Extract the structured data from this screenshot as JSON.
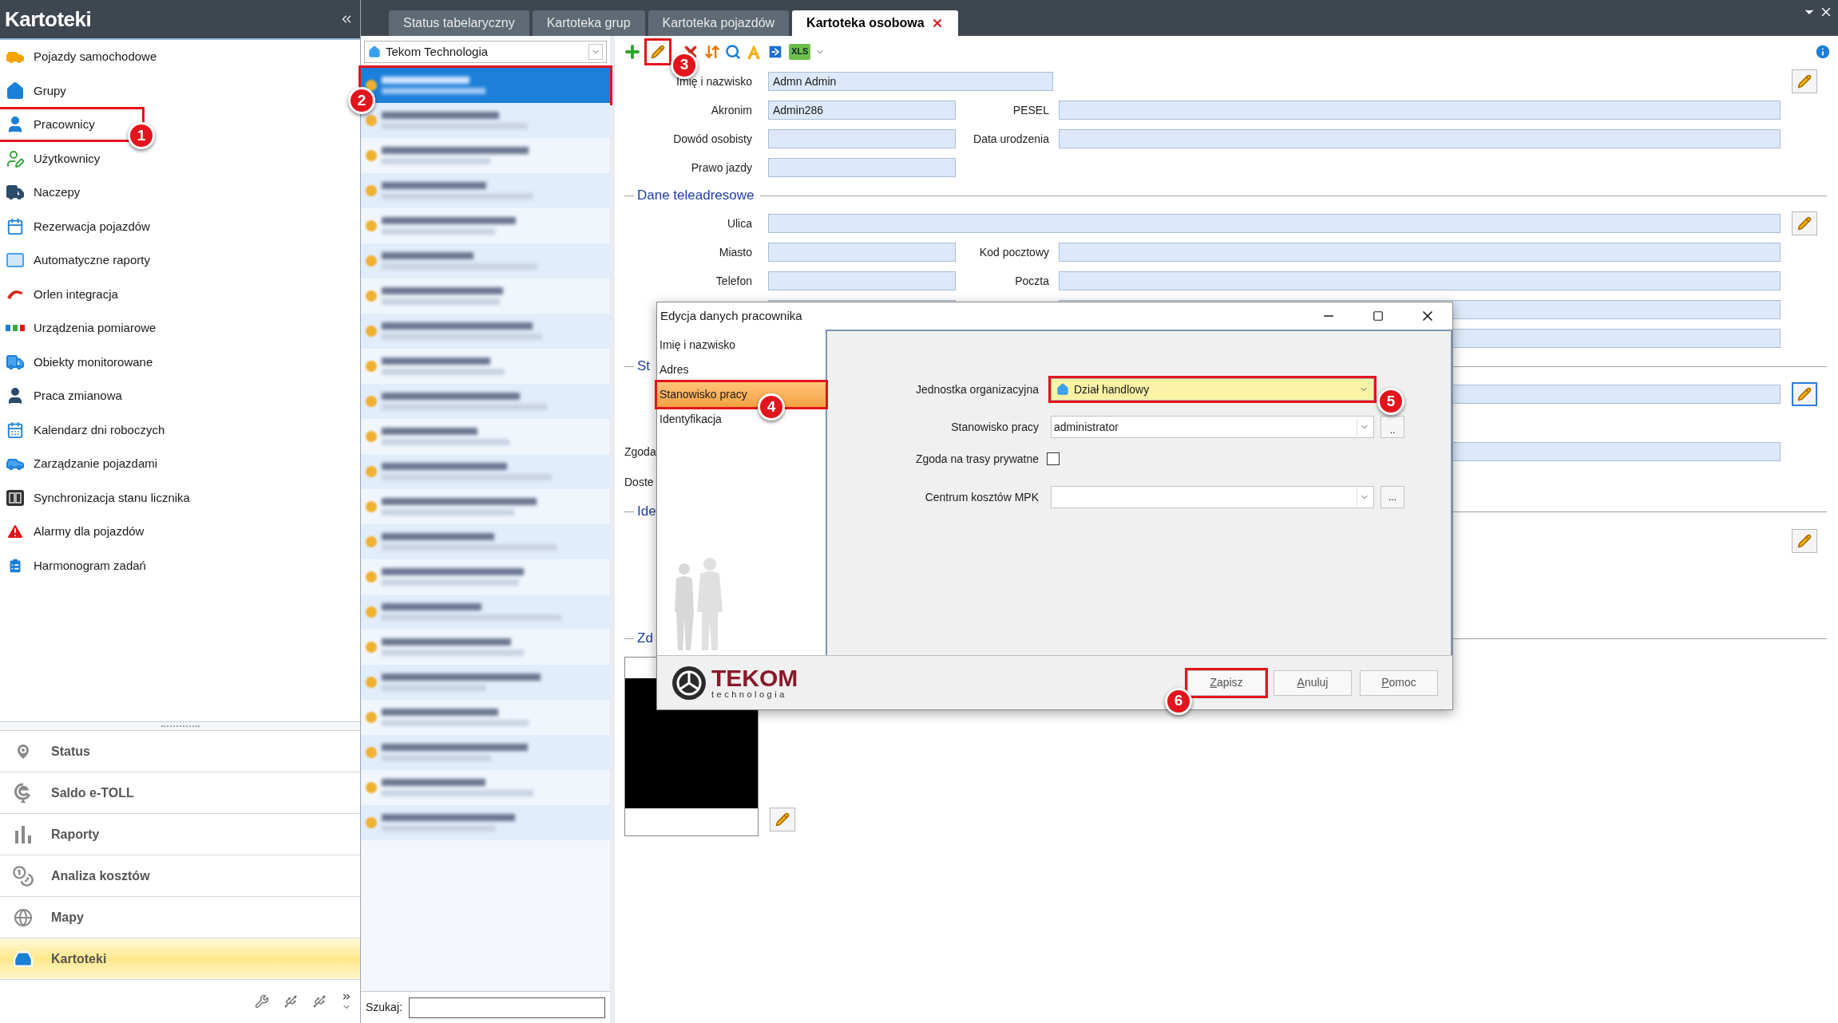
{
  "sidebar": {
    "title": "Kartoteki",
    "items": [
      {
        "label": "Pojazdy samochodowe",
        "highlighted": false
      },
      {
        "label": "Grupy",
        "highlighted": false
      },
      {
        "label": "Pracownicy",
        "highlighted": true,
        "callout": "1"
      },
      {
        "label": "Użytkownicy",
        "highlighted": false
      },
      {
        "label": "Naczepy",
        "highlighted": false
      },
      {
        "label": "Rezerwacja pojazdów",
        "highlighted": false
      },
      {
        "label": "Automatyczne raporty",
        "highlighted": false
      },
      {
        "label": "Orlen integracja",
        "highlighted": false
      },
      {
        "label": "Urządzenia pomiarowe",
        "highlighted": false
      },
      {
        "label": "Obiekty monitorowane",
        "highlighted": false
      },
      {
        "label": "Praca zmianowa",
        "highlighted": false
      },
      {
        "label": "Kalendarz dni roboczych",
        "highlighted": false
      },
      {
        "label": "Zarządzanie pojazdami",
        "highlighted": false
      },
      {
        "label": "Synchronizacja stanu licznika",
        "highlighted": false
      },
      {
        "label": "Alarmy dla pojazdów",
        "highlighted": false
      },
      {
        "label": "Harmonogram zadań",
        "highlighted": false
      }
    ],
    "modules": [
      {
        "label": "Status",
        "selected": false
      },
      {
        "label": "Saldo e-TOLL",
        "selected": false
      },
      {
        "label": "Raporty",
        "selected": false
      },
      {
        "label": "Analiza kosztów",
        "selected": false
      },
      {
        "label": "Mapy",
        "selected": false
      },
      {
        "label": "Kartoteki",
        "selected": true
      }
    ]
  },
  "tabs": [
    {
      "label": "Status tabelaryczny",
      "selected": false
    },
    {
      "label": "Kartoteka grup",
      "selected": false
    },
    {
      "label": "Kartoteka pojazdów",
      "selected": false
    },
    {
      "label": "Kartoteka osobowa",
      "selected": true
    }
  ],
  "employee_list": {
    "company": "Tekom Technologia",
    "search_label": "Szukaj:",
    "rows": [
      {
        "selected": true,
        "highlighted": true,
        "callout": "2"
      },
      {
        "selected": false,
        "highlighted": false
      },
      {
        "selected": false,
        "highlighted": false
      },
      {
        "selected": false,
        "highlighted": false
      },
      {
        "selected": false,
        "highlighted": false
      },
      {
        "selected": false,
        "highlighted": false
      },
      {
        "selected": false,
        "highlighted": false
      },
      {
        "selected": false,
        "highlighted": false
      },
      {
        "selected": false,
        "highlighted": false
      },
      {
        "selected": false,
        "highlighted": false
      },
      {
        "selected": false,
        "highlighted": false
      },
      {
        "selected": false,
        "highlighted": false
      },
      {
        "selected": false,
        "highlighted": false
      },
      {
        "selected": false,
        "highlighted": false
      },
      {
        "selected": false,
        "highlighted": false
      },
      {
        "selected": false,
        "highlighted": false
      },
      {
        "selected": false,
        "highlighted": false
      },
      {
        "selected": false,
        "highlighted": false
      },
      {
        "selected": false,
        "highlighted": false
      },
      {
        "selected": false,
        "highlighted": false
      },
      {
        "selected": false,
        "highlighted": false
      },
      {
        "selected": false,
        "highlighted": false
      }
    ]
  },
  "toolbar": {
    "edit_callout": "3",
    "export_label": "XLS"
  },
  "form": {
    "name_label": "Imię i nazwisko",
    "name_value": "Admn Admin",
    "acronym_label": "Akronim",
    "acronym_value": "Admin286",
    "pesel_label": "PESEL",
    "id_card_label": "Dowód osobisty",
    "birth_label": "Data urodzenia",
    "license_label": "Prawo jazdy",
    "contact_title": "Dane teleadresowe",
    "street_label": "Ulica",
    "city_label": "Miasto",
    "postcode_label": "Kod pocztowy",
    "phone_label": "Telefon",
    "post_label": "Poczta",
    "employment_title": "St",
    "consent_label": "Zgoda",
    "access_label": "Doste",
    "identification_title": "Ide",
    "photo_title": "Zd"
  },
  "dialog": {
    "title": "Edycja danych pracownika",
    "nav": [
      {
        "label": "Imię i nazwisko",
        "selected": false,
        "highlighted": false
      },
      {
        "label": "Adres",
        "selected": false,
        "highlighted": false
      },
      {
        "label": "Stanowisko pracy",
        "selected": true,
        "highlighted": true,
        "callout": "4"
      },
      {
        "label": "Identyfikacja",
        "selected": false,
        "highlighted": false
      }
    ],
    "unit_label": "Jednostka organizacyjna",
    "unit_value": "Dział handlowy",
    "unit_highlighted": true,
    "unit_callout": "5",
    "position_label": "Stanowisko pracy",
    "position_value": "administrator",
    "position_more": "..",
    "consent_label": "Zgoda na trasy prywatne",
    "consent_checked": false,
    "cost_label": "Centrum kosztów MPK",
    "cost_more": "...",
    "logo_name": "TEKOM",
    "logo_tagline": "technologia",
    "buttons": [
      {
        "label": "Zapisz",
        "highlighted": true,
        "callout": "6"
      },
      {
        "label": "Anuluj",
        "highlighted": false
      },
      {
        "label": "Pomoc",
        "highlighted": false
      }
    ]
  }
}
